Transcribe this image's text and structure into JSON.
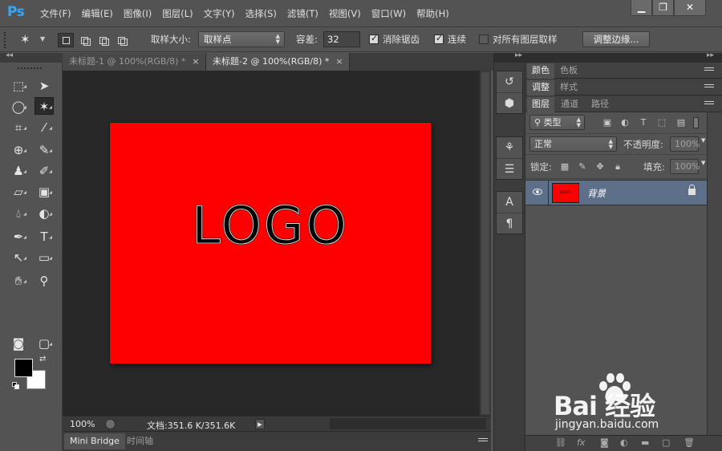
{
  "app": {
    "logo": "Ps",
    "menu": [
      "文件(F)",
      "编辑(E)",
      "图像(I)",
      "图层(L)",
      "文字(Y)",
      "选择(S)",
      "滤镜(T)",
      "视图(V)",
      "窗口(W)",
      "帮助(H)"
    ],
    "window_controls": {
      "minimize": "▁",
      "restore": "❐",
      "close": "✕"
    }
  },
  "options_bar": {
    "tool_icon": "magic-wand-icon",
    "sample_size_label": "取样大小:",
    "sample_size_value": "取样点",
    "tolerance_label": "容差:",
    "tolerance_value": "32",
    "anti_alias_label": "消除锯齿",
    "anti_alias_checked": true,
    "contiguous_label": "连续",
    "contiguous_checked": true,
    "sample_all_layers_label": "对所有图层取样",
    "sample_all_layers_checked": false,
    "refine_edge_label": "调整边缘..."
  },
  "documents": {
    "tabs": [
      {
        "label": "未标题-1 @ 100%(RGB/8) *",
        "active": false
      },
      {
        "label": "未标题-2 @ 100%(RGB/8) *",
        "active": true
      }
    ],
    "canvas_text": "LOGO",
    "canvas_color": "#ff0000"
  },
  "statusbar": {
    "zoom": "100%",
    "doc_info": "文档:351.6 K/351.6K"
  },
  "bottom_tabs": [
    "Mini Bridge",
    "时间轴"
  ],
  "panels": {
    "group1": [
      "颜色",
      "色板"
    ],
    "group2": [
      "调整",
      "样式"
    ],
    "group3": [
      "图层",
      "通道",
      "路径"
    ],
    "layers": {
      "filter_type": "类型",
      "blend_mode": "正常",
      "opacity_label": "不透明度:",
      "opacity_value": "100%",
      "lock_label": "锁定:",
      "fill_label": "填充:",
      "fill_value": "100%",
      "items": [
        {
          "name": "背景",
          "thumb_text": "LOGO",
          "locked": true,
          "visible": true
        }
      ],
      "footer_fx": "fx"
    }
  },
  "watermark": {
    "brand": "Bai  经验",
    "url": "jingyan.baidu.com"
  },
  "colors": {
    "accent_ps": "#31a8ff",
    "foreground": "#000000",
    "background": "#ffffff",
    "layer_selected": "#5e6f8a"
  }
}
